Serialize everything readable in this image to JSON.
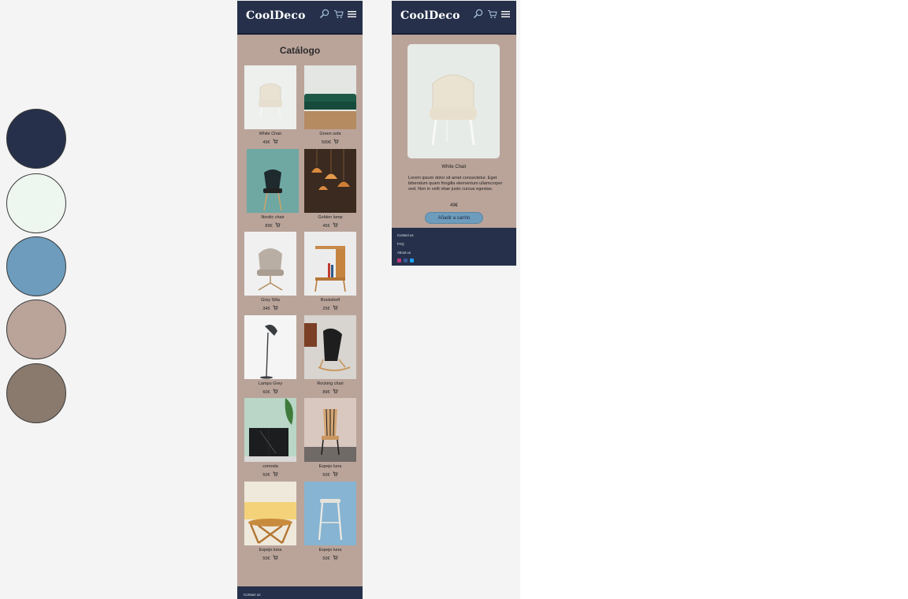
{
  "palette": [
    "#26304a",
    "#eef7ef",
    "#6d9cbc",
    "#baa49a",
    "#8a7a6d"
  ],
  "brand": {
    "logo_cool": "Cool",
    "logo_deco": "Deco"
  },
  "catalog": {
    "title": "Catálogo",
    "products": [
      {
        "name": "White Chair",
        "price": "49€",
        "icon": "white-armchair"
      },
      {
        "name": "Green sofa",
        "price": "599€",
        "icon": "green-sofa"
      },
      {
        "name": "Nordic chair",
        "price": "89€",
        "icon": "nordic-chair"
      },
      {
        "name": "Golden lamp",
        "price": "45€",
        "icon": "golden-lamp"
      },
      {
        "name": "Grey Silla",
        "price": "345",
        "icon": "grey-swivel-chair"
      },
      {
        "name": "Bookshelf",
        "price": "25€",
        "icon": "bookshelf-table"
      },
      {
        "name": "Lampu Grey",
        "price": "60€",
        "icon": "floor-lamp"
      },
      {
        "name": "Rocking chari",
        "price": "89€",
        "icon": "rocking-chair"
      },
      {
        "name": "comoda",
        "price": "50€",
        "icon": "marble-dresser"
      },
      {
        "name": "Espejo luna",
        "price": "50€",
        "icon": "wooden-chair"
      },
      {
        "name": "Espejo luna",
        "price": "50€",
        "icon": "rattan-table"
      },
      {
        "name": "Espejo luna",
        "price": "50€",
        "icon": "white-stool"
      }
    ]
  },
  "footer_catalog": {
    "contact": "Contact us"
  },
  "detail": {
    "name": "White Chair",
    "description": "Lorem ipsum dolor sit amet consectetur. Eget bibendum quam fringilla elementum ullamcorper sed. Non in velit vitae justo cursus egestas.",
    "price": "49€",
    "button": "Añadir a carrito"
  },
  "footer_detail": {
    "contact": "Contact us",
    "faq": "FAQ",
    "about": "About us"
  }
}
